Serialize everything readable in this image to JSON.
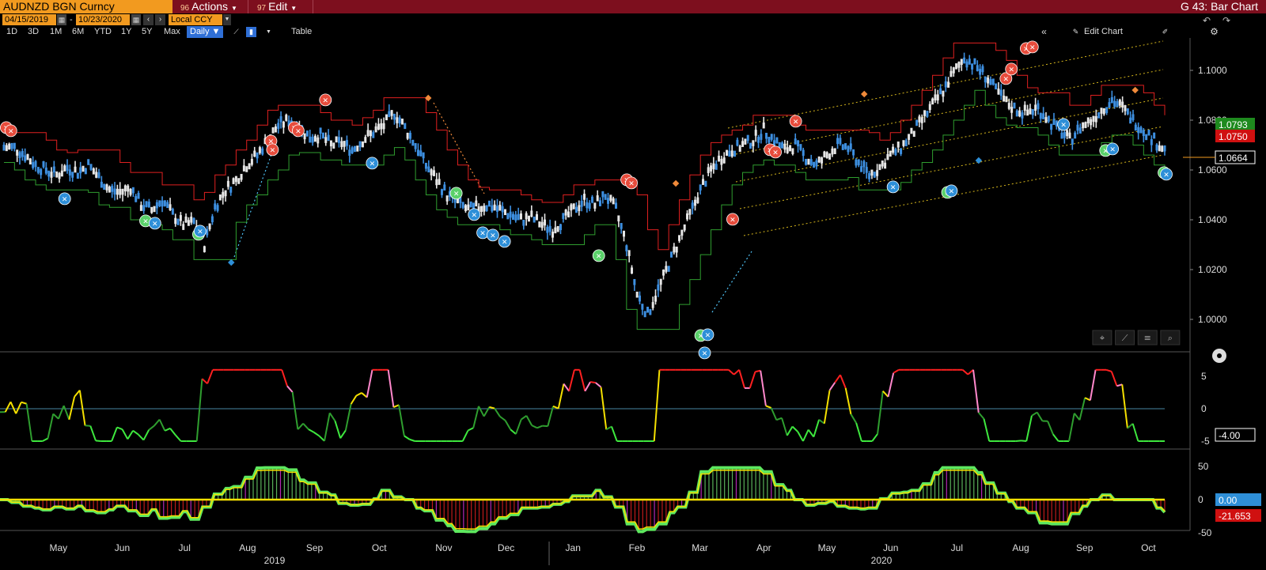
{
  "header": {
    "security": "AUDNZD BGN Curncy",
    "actions_num": "96",
    "actions_label": "Actions",
    "edit_num": "97",
    "edit_label": "Edit",
    "chart_title": "G 43: Bar Chart"
  },
  "dates": {
    "start": "04/15/2019",
    "end": "10/23/2020",
    "currency": "Local CCY"
  },
  "toolbar": {
    "ranges": [
      "1D",
      "3D",
      "1M",
      "6M",
      "YTD",
      "1Y",
      "5Y",
      "Max"
    ],
    "period": "Daily ▼",
    "table_label": "Table",
    "edit_chart_label": "Edit Chart"
  },
  "colors": {
    "title_bar": "#7d0f1e",
    "accent": "#f29a1f",
    "up_bar": "#e6e6e6",
    "down_bar": "#3d8fe0",
    "resistance": "#e02020",
    "support": "#2f9e2f",
    "channel": "#d4b51c"
  },
  "chart_data": [
    {
      "type": "line",
      "panel": "price",
      "ylim": [
        0.985,
        1.115
      ],
      "yticks": [
        "1.1000",
        "1.0800",
        "1.0600",
        "1.0400",
        "1.0200",
        "1.0000"
      ],
      "xticks": [
        "May",
        "Jun",
        "Jul",
        "Aug",
        "Sep",
        "Oct",
        "Nov",
        "Dec",
        "Jan",
        "Feb",
        "Mar",
        "Apr",
        "May",
        "Jun",
        "Jul",
        "Aug",
        "Sep",
        "Oct"
      ],
      "years": [
        "2019",
        "2020"
      ],
      "tags": [
        {
          "value": "1.0793",
          "color": "#1e8a1e"
        },
        {
          "value": "1.0750",
          "color": "#d01010"
        },
        {
          "value": "1.0664",
          "color": "#ffffff"
        }
      ],
      "series": [
        {
          "values": [
            1.069,
            1.066,
            1.062,
            1.06,
            1.058,
            1.061,
            1.059,
            1.062,
            1.057,
            1.052,
            1.051,
            1.053,
            1.046,
            1.044,
            1.048,
            1.042,
            1.038,
            1.039,
            1.03,
            1.045,
            1.052,
            1.056,
            1.062,
            1.066,
            1.072,
            1.078,
            1.08,
            1.077,
            1.073,
            1.074,
            1.07,
            1.071,
            1.068,
            1.072,
            1.075,
            1.078,
            1.083,
            1.077,
            1.07,
            1.062,
            1.056,
            1.05,
            1.047,
            1.044,
            1.045,
            1.046,
            1.044,
            1.042,
            1.04,
            1.041,
            1.038,
            1.036,
            1.04,
            1.044,
            1.048,
            1.046,
            1.05,
            1.044,
            1.03,
            1.01,
            1.002,
            1.012,
            1.022,
            1.032,
            1.042,
            1.052,
            1.06,
            1.065,
            1.068,
            1.07,
            1.072,
            1.076,
            1.072,
            1.068,
            1.07,
            1.065,
            1.062,
            1.066,
            1.07,
            1.069,
            1.063,
            1.058,
            1.061,
            1.066,
            1.069,
            1.074,
            1.08,
            1.086,
            1.092,
            1.099,
            1.105,
            1.102,
            1.098,
            1.092,
            1.087,
            1.084,
            1.083,
            1.085,
            1.08,
            1.076,
            1.072,
            1.077,
            1.08,
            1.084,
            1.088,
            1.085,
            1.08,
            1.076,
            1.072,
            1.068,
            1.0664
          ]
        }
      ]
    },
    {
      "type": "line",
      "panel": "oscillator",
      "ylim": [
        -7,
        7
      ],
      "yticks": [
        "5",
        "0",
        "-5"
      ],
      "tags": [
        {
          "value": "-4.00",
          "color": "#ffffff"
        }
      ]
    },
    {
      "type": "area",
      "panel": "histogram",
      "ylim": [
        -60,
        60
      ],
      "yticks": [
        "50",
        "0",
        "-50"
      ],
      "tags": [
        {
          "value": "0.00",
          "color": "#2e8fd8"
        },
        {
          "value": "-21.653",
          "color": "#d01010"
        }
      ]
    }
  ]
}
